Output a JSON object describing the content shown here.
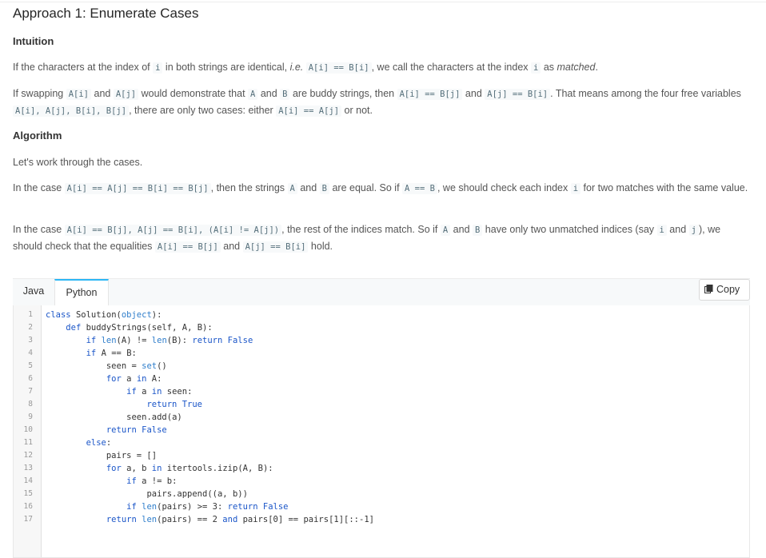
{
  "article": {
    "title": "Approach 1: Enumerate Cases",
    "intuition_heading": "Intuition",
    "intuition_p1": [
      {
        "t": "text",
        "v": "If the characters at the index of "
      },
      {
        "t": "code",
        "v": "i"
      },
      {
        "t": "text",
        "v": " in both strings are identical, "
      },
      {
        "t": "em",
        "v": "i.e."
      },
      {
        "t": "text",
        "v": " "
      },
      {
        "t": "code",
        "v": "A[i] == B[i]"
      },
      {
        "t": "text",
        "v": ", we call the characters at the index "
      },
      {
        "t": "code",
        "v": "i"
      },
      {
        "t": "text",
        "v": " as "
      },
      {
        "t": "em",
        "v": "matched"
      },
      {
        "t": "text",
        "v": "."
      }
    ],
    "intuition_p2": [
      {
        "t": "text",
        "v": "If swapping "
      },
      {
        "t": "code",
        "v": "A[i]"
      },
      {
        "t": "text",
        "v": " and "
      },
      {
        "t": "code",
        "v": "A[j]"
      },
      {
        "t": "text",
        "v": " would demonstrate that "
      },
      {
        "t": "code",
        "v": "A"
      },
      {
        "t": "text",
        "v": " and "
      },
      {
        "t": "code",
        "v": "B"
      },
      {
        "t": "text",
        "v": " are buddy strings, then "
      },
      {
        "t": "code",
        "v": "A[i] == B[j]"
      },
      {
        "t": "text",
        "v": " and "
      },
      {
        "t": "code",
        "v": "A[j] == B[i]"
      },
      {
        "t": "text",
        "v": ". That means among the four free variables "
      },
      {
        "t": "code",
        "v": "A[i], A[j], B[i], B[j]"
      },
      {
        "t": "text",
        "v": ", there are only two cases: either "
      },
      {
        "t": "code",
        "v": "A[i] == A[j]"
      },
      {
        "t": "text",
        "v": " or not."
      }
    ],
    "algorithm_heading": "Algorithm",
    "algo_p1": [
      {
        "t": "text",
        "v": "Let's work through the cases."
      }
    ],
    "algo_p2": [
      {
        "t": "text",
        "v": "In the case "
      },
      {
        "t": "code",
        "v": "A[i] == A[j] == B[i] == B[j]"
      },
      {
        "t": "text",
        "v": ", then the strings "
      },
      {
        "t": "code",
        "v": "A"
      },
      {
        "t": "text",
        "v": " and "
      },
      {
        "t": "code",
        "v": "B"
      },
      {
        "t": "text",
        "v": " are equal. So if "
      },
      {
        "t": "code",
        "v": "A == B"
      },
      {
        "t": "text",
        "v": ", we should check each index "
      },
      {
        "t": "code",
        "v": "i"
      },
      {
        "t": "text",
        "v": " for two matches with the same value."
      }
    ],
    "algo_p3": [
      {
        "t": "text",
        "v": "In the case "
      },
      {
        "t": "code",
        "v": "A[i] == B[j], A[j] == B[i], (A[i] != A[j])"
      },
      {
        "t": "text",
        "v": ", the rest of the indices match. So if "
      },
      {
        "t": "code",
        "v": "A"
      },
      {
        "t": "text",
        "v": " and "
      },
      {
        "t": "code",
        "v": "B"
      },
      {
        "t": "text",
        "v": " have only two unmatched indices (say "
      },
      {
        "t": "code",
        "v": "i"
      },
      {
        "t": "text",
        "v": " and "
      },
      {
        "t": "code",
        "v": "j"
      },
      {
        "t": "text",
        "v": "), we should check that the equalities "
      },
      {
        "t": "code",
        "v": "A[i] == B[j]"
      },
      {
        "t": "text",
        "v": " and "
      },
      {
        "t": "code",
        "v": "A[j] == B[i]"
      },
      {
        "t": "text",
        "v": " hold."
      }
    ]
  },
  "code_panel": {
    "tabs": [
      "Java",
      "Python"
    ],
    "active_tab": "Python",
    "copy_label": "Copy",
    "icon": "copy-icon",
    "accent_color": "#2db7f5",
    "lines": [
      "class Solution(object):",
      "    def buddyStrings(self, A, B):",
      "        if len(A) != len(B): return False",
      "        if A == B:",
      "            seen = set()",
      "            for a in A:",
      "                if a in seen:",
      "                    return True",
      "                seen.add(a)",
      "            return False",
      "        else:",
      "            pairs = []",
      "            for a, b in itertools.izip(A, B):",
      "                if a != b:",
      "                    pairs.append((a, b))",
      "                if len(pairs) >= 3: return False",
      "            return len(pairs) == 2 and pairs[0] == pairs[1][::-1]"
    ]
  }
}
